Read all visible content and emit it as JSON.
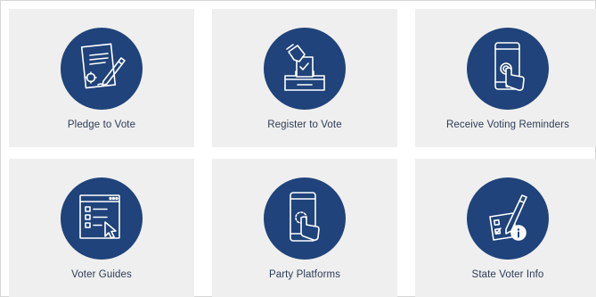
{
  "colors": {
    "tile_background": "#efefef",
    "icon_circle": "#1f437a",
    "icon_stroke": "#ffffff",
    "label_text": "#2d3b57"
  },
  "tiles": [
    {
      "label": "Pledge to Vote",
      "icon": "pledge-document-pen-icon"
    },
    {
      "label": "Register to Vote",
      "icon": "ballot-box-icon"
    },
    {
      "label": "Receive Voting Reminders",
      "icon": "phone-tap-icon"
    },
    {
      "label": "Voter Guides",
      "icon": "checklist-window-icon"
    },
    {
      "label": "Party Platforms",
      "icon": "phone-touch-icon"
    },
    {
      "label": "State Voter Info",
      "icon": "pencil-checkbox-info-icon"
    }
  ]
}
